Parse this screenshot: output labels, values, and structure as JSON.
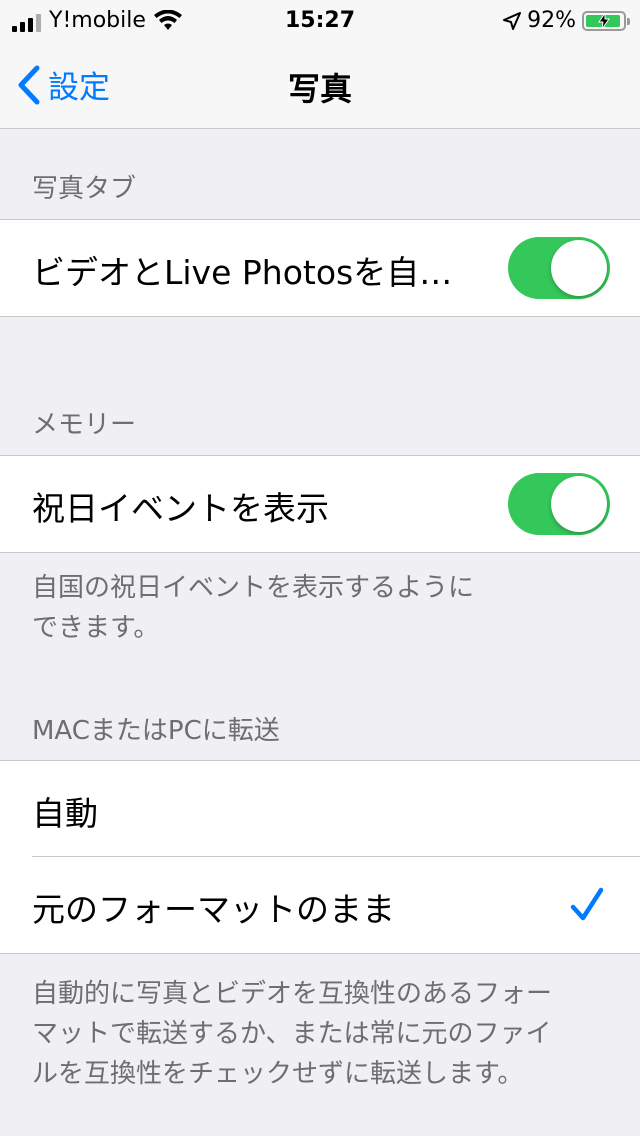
{
  "status_bar": {
    "carrier": "Y!mobile",
    "time": "15:27",
    "battery_percent": "92%",
    "battery_level": 0.92,
    "icons": [
      "signal-bars-icon",
      "wifi-icon",
      "location-arrow-icon",
      "battery-charging-icon"
    ]
  },
  "nav": {
    "back_label": "設定",
    "title": "写真"
  },
  "photos_tab": {
    "header": "写真タブ",
    "autoplay_label": "ビデオとLive Photosを自…",
    "autoplay_on": true
  },
  "memories": {
    "header": "メモリー",
    "holiday_label": "祝日イベントを表示",
    "holiday_on": true,
    "footer_line1": "自国の祝日イベントを表示するように",
    "footer_line2": "できます。"
  },
  "transfer": {
    "header": "MACまたはPCに転送",
    "option_auto": "自動",
    "option_original": "元のフォーマットのまま",
    "selected": "元のフォーマットのまま",
    "footer_line1": "自動的に写真とビデオを互換性のあるフォー",
    "footer_line2": "マットで転送するか、または常に元のファイ",
    "footer_line3": "ルを互換性をチェックせずに転送します。"
  },
  "colors": {
    "accent": "#007aff",
    "toggle_on": "#34c759",
    "background": "#efeff4",
    "secondary_text": "#6d6d72"
  }
}
